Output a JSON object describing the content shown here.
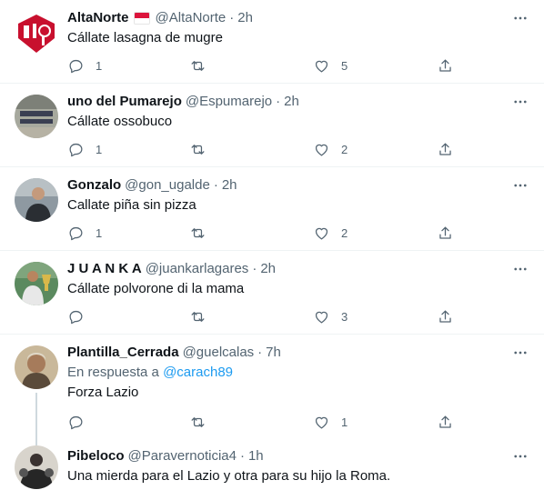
{
  "tweets": [
    {
      "name": "AltaNorte",
      "has_flag": true,
      "handle": "@AltaNorte",
      "sep": "·",
      "time": "2h",
      "text": "Cállate lasagna de mugre",
      "reply_count": "1",
      "retweet_count": "",
      "like_count": "5",
      "avatar_color": "#c8102e"
    },
    {
      "name": "uno del Pumarejo",
      "handle": "@Espumarejo",
      "sep": "·",
      "time": "2h",
      "text": "Cállate ossobuco",
      "reply_count": "1",
      "retweet_count": "",
      "like_count": "2",
      "avatar_color": "#8a8f86"
    },
    {
      "name": "Gonzalo",
      "handle": "@gon_ugalde",
      "sep": "·",
      "time": "2h",
      "text": "Callate piña sin pizza",
      "reply_count": "1",
      "retweet_count": "",
      "like_count": "2",
      "avatar_color": "#4a5560"
    },
    {
      "name": "J U A N K A",
      "handle": "@juankarlagares",
      "sep": "·",
      "time": "2h",
      "text": "Cállate polvorone di la mama",
      "reply_count": "",
      "retweet_count": "",
      "like_count": "3",
      "avatar_color": "#3d6b45"
    },
    {
      "name": "Plantilla_Cerrada",
      "handle": "@guelcalas",
      "sep": "·",
      "time": "7h",
      "reply_prefix": "En respuesta a",
      "reply_target": "@carach89",
      "text": "Forza Lazio",
      "reply_count": "",
      "retweet_count": "",
      "like_count": "1",
      "avatar_color": "#6b5a45"
    },
    {
      "name": "Pibeloco",
      "handle": "@Paravernoticia4",
      "sep": "·",
      "time": "1h",
      "text": "Una mierda para el Lazio y otra para su hijo la Roma.",
      "avatar_color": "#3a3a3a"
    }
  ],
  "colors": {
    "text": "#0f1419",
    "secondary": "#536471",
    "link": "#1d9bf0",
    "divider": "#eff3f4",
    "thread_line": "#cfd9de"
  }
}
